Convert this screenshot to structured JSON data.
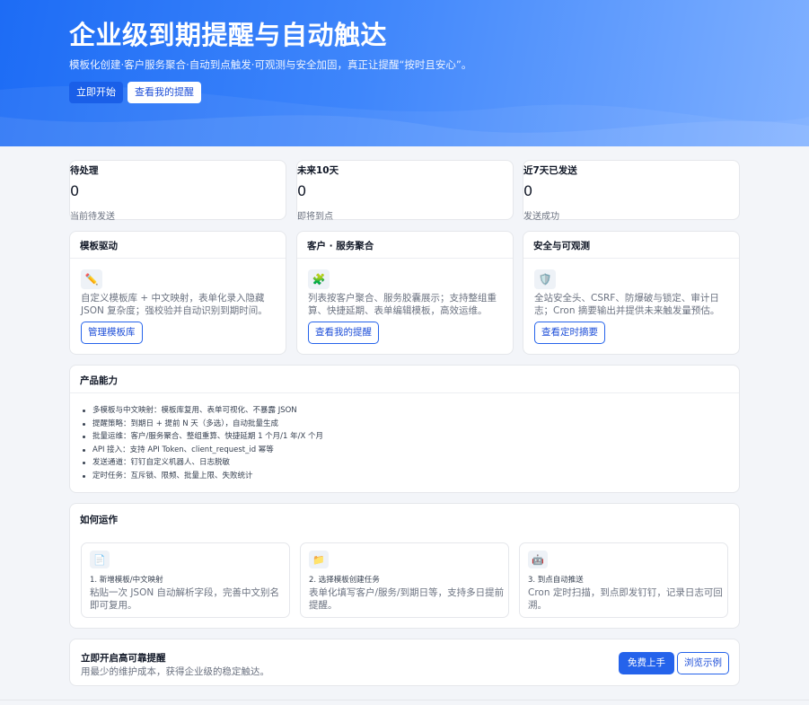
{
  "hero": {
    "title": "企业级到期提醒与自动触达",
    "subtitle": "模板化创建·客户服务聚合·自动到点触发·可观测与安全加固，真正让提醒“按时且安心”。",
    "primary_label": "立即开始",
    "secondary_label": "查看我的提醒"
  },
  "stats": [
    {
      "label": "待处理",
      "value": "0",
      "caption": "当前待发送"
    },
    {
      "label": "未来10天",
      "value": "0",
      "caption": "即将到点"
    },
    {
      "label": "近7天已发送",
      "value": "0",
      "caption": "发送成功"
    }
  ],
  "features": [
    {
      "title": "模板驱动",
      "icon": "pencil-icon",
      "glyph": "✏️",
      "desc": "自定义模板库 + 中文映射，表单化录入隐藏 JSON 复杂度；强校验并自动识别到期时间。",
      "button": "管理模板库"
    },
    {
      "title": "客户 · 服务聚合",
      "icon": "puzzle-icon",
      "glyph": "🧩",
      "desc": "列表按客户聚合、服务胶囊展示；支持整组重算、快捷延期、表单编辑模板，高效运维。",
      "button": "查看我的提醒"
    },
    {
      "title": "安全与可观测",
      "icon": "shield-icon",
      "glyph": "🛡️",
      "desc": "全站安全头、CSRF、防爆破与锁定、审计日志；Cron 摘要输出并提供未来触发量预估。",
      "button": "查看定时摘要"
    }
  ],
  "capabilities": {
    "title": "产品能力",
    "items": [
      "多模板与中文映射：模板库复用、表单可视化、不暴露 JSON",
      "提醒策略：到期日 + 提前 N 天（多选），自动批量生成",
      "批量运维：客户/服务聚合、整组重算、快捷延期 1 个月/1 年/X 个月",
      "API 接入：支持 API Token、client_request_id 幂等",
      "发送通道：钉钉自定义机器人、日志脱敏",
      "定时任务：互斥锁、限频、批量上限、失败统计"
    ]
  },
  "how": {
    "title": "如何运作",
    "steps": [
      {
        "icon": "document-icon",
        "glyph": "📄",
        "title": "1. 新增模板/中文映射",
        "desc": "粘贴一次 JSON 自动解析字段，完善中文别名即可复用。"
      },
      {
        "icon": "folder-icon",
        "glyph": "📁",
        "title": "2. 选择模板创建任务",
        "desc": "表单化填写客户/服务/到期日等，支持多日提前提醒。"
      },
      {
        "icon": "robot-icon",
        "glyph": "🤖",
        "title": "3. 到点自动推送",
        "desc": "Cron 定时扫描，到点即发钉钉，记录日志可回溯。"
      }
    ]
  },
  "cta": {
    "title": "立即开启高可靠提醒",
    "subtitle": "用最少的维护成本，获得企业级的稳定触达。",
    "primary_label": "免费上手",
    "secondary_label": "浏览示例"
  },
  "colors": {
    "accent": "#2563eb",
    "hero_start": "#1d6cf5",
    "hero_end": "#7fb0ff"
  }
}
